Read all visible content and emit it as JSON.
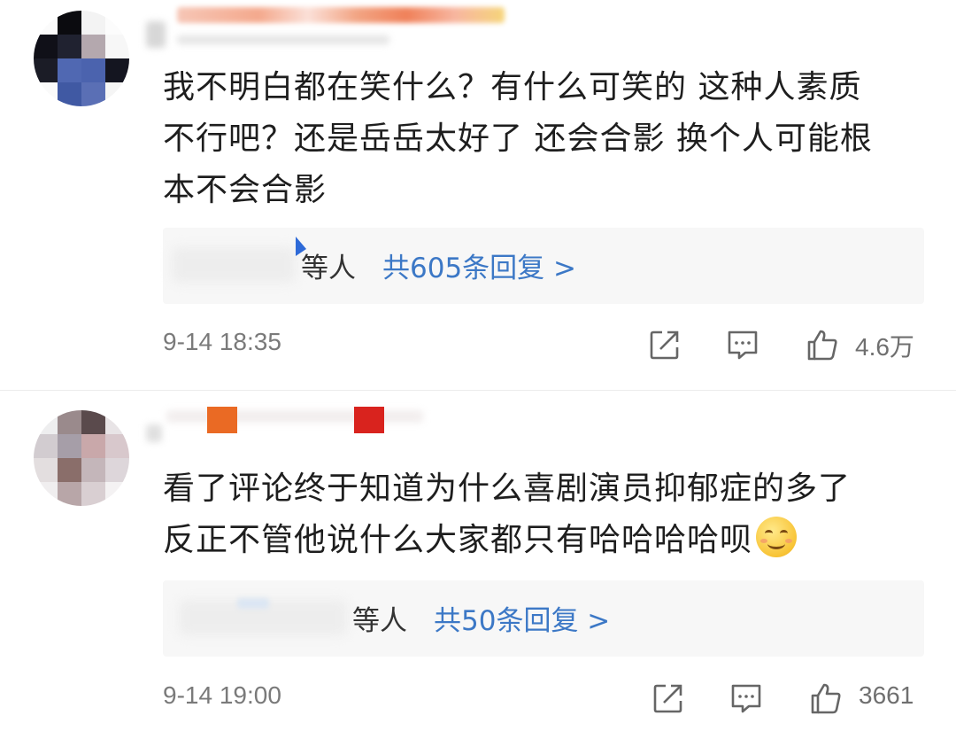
{
  "comments": [
    {
      "text_lines": [
        "我不明白都在笑什么？有什么可笑的 这种人素质",
        "不行吧？还是岳岳太好了 还会合影 换个人可能根",
        "本不会合影"
      ],
      "reply_who": "等人",
      "reply_count": "共605条回复 >",
      "time": "9-14 18:35",
      "likes": "4.6万"
    },
    {
      "text_lines": [
        "看了评论终于知道为什么喜剧演员抑郁症的多了",
        "反正不管他说什么大家都只有哈哈哈哈呗"
      ],
      "reply_who": "等人",
      "reply_count": "共50条回复 >",
      "time": "9-14 19:00",
      "likes": "3661"
    }
  ],
  "icons": {
    "share": "share-icon",
    "comment": "comment-icon",
    "like": "thumbs-up-icon",
    "emoji": "smiling-face-emoji"
  },
  "colors": {
    "link": "#3c78c6",
    "reply_bg": "#f7f7f7",
    "meta": "#7a7a7a"
  }
}
